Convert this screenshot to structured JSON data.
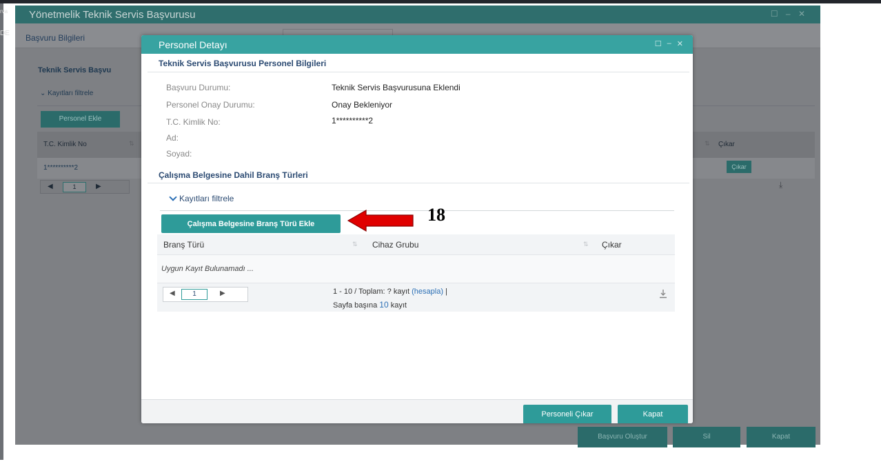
{
  "background": {
    "edge_text_top": "rva",
    "edge_text": "DE",
    "window_title": "Yönetmelik Teknik Servis Başvurusu",
    "tab_basvuru": "Başvuru Bilgileri",
    "section_title": "Teknik Servis Başvu",
    "filter_label": "Kayıtları filtrele",
    "add_personel_label": "Personel Ekle",
    "col_tc": "T.C. Kimlik No",
    "col_cikar": "Çıkar",
    "row_tc": "1**********2",
    "row_cikar_btn": "Çıkar",
    "page_num": "1",
    "footer_buttons": [
      "Başvuru Oluştur",
      "Sil",
      "Kapat"
    ]
  },
  "modal": {
    "title": "Personel Detayı",
    "section1_title": "Teknik Servis Başvurusu Personel Bilgileri",
    "fields": [
      {
        "label": "Başvuru Durumu:",
        "value": "Teknik Servis Başvurusuna Eklendi"
      },
      {
        "label": "Personel Onay Durumu:",
        "value": "Onay Bekleniyor"
      },
      {
        "label": "T.C. Kimlik No:",
        "value": "1**********2"
      },
      {
        "label": "Ad:",
        "value": ""
      },
      {
        "label": "Soyad:",
        "value": ""
      }
    ],
    "section2_title": "Çalışma Belgesine Dahil Branş Türleri",
    "filter_label": "Kayıtları filtrele",
    "add_button": "Çalışma Belgesine Branş Türü Ekle",
    "table": {
      "columns": [
        "Branş Türü",
        "Cihaz Grubu",
        "Çıkar"
      ],
      "empty_text": "Uygun Kayıt Bulunamadı ..."
    },
    "pager": {
      "page": "1",
      "info_prefix": "1 - 10 / Toplam: ? kayıt",
      "info_link": "(hesapla)",
      "info_sep": "|",
      "per_page_prefix": "Sayfa başına",
      "per_page_value": "10",
      "per_page_suffix": "kayıt"
    },
    "footer": {
      "remove_label": "Personeli Çıkar",
      "close_label": "Kapat"
    }
  },
  "annotation": {
    "step": "18"
  },
  "colors": {
    "accent": "#2e9b99",
    "title_bar": "#38a3a1",
    "heading": "#2b4a72",
    "arrow": "#e00000"
  }
}
